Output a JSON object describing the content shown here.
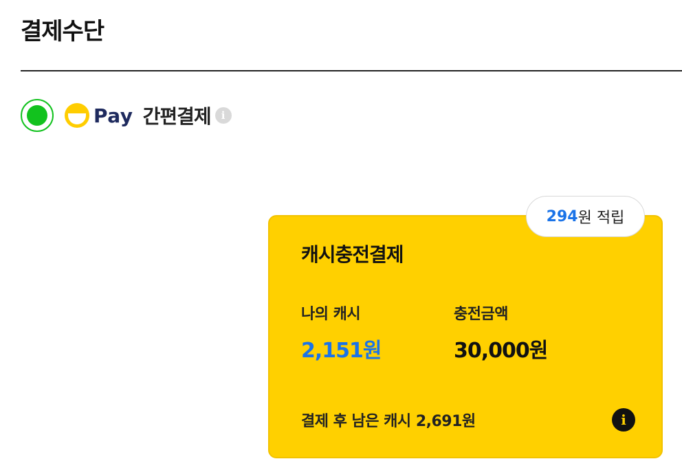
{
  "section": {
    "title": "결제수단"
  },
  "payment_method": {
    "selected": true,
    "brand": "Pay",
    "label": "간편결제",
    "info_icon": "i"
  },
  "card": {
    "reward": {
      "amount": "294",
      "suffix": "원 적립"
    },
    "title": "캐시충전결제",
    "my_cash": {
      "label": "나의 캐시",
      "value": "2,151원"
    },
    "charge_amount": {
      "label": "충전금액",
      "value": "30,000원"
    },
    "remaining_text": "결제 후 남은 캐시 2,691원",
    "info_icon": "i"
  },
  "colors": {
    "accent_green": "#12c21e",
    "card_yellow": "#ffd000",
    "link_blue": "#1a73e8",
    "brand_navy": "#1e2a5e"
  }
}
